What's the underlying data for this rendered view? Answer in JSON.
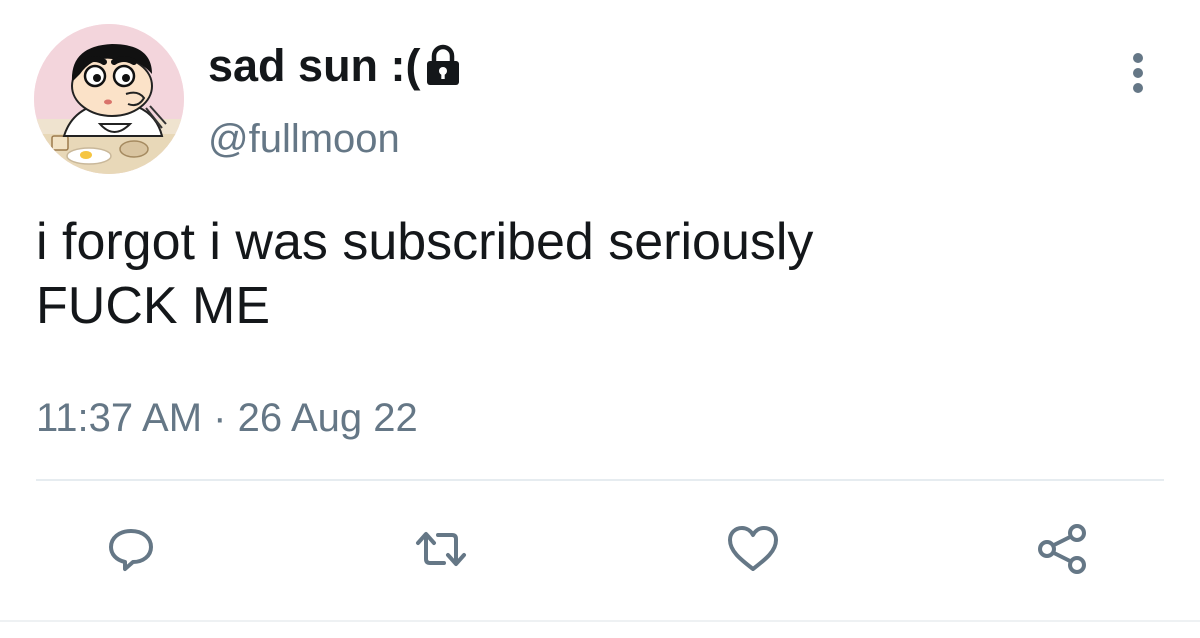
{
  "user": {
    "display_name": "sad sun :(",
    "handle": "@fullmoon",
    "verified_lock": "lock-icon",
    "avatar": "cartoon-boy-avatar"
  },
  "tweet": {
    "text": "i forgot i was subscribed seriously\nFUCK ME",
    "timestamp": "11:37 AM · 26 Aug 22"
  },
  "actions": [
    {
      "name": "reply",
      "icon": "reply-icon"
    },
    {
      "name": "retweet",
      "icon": "retweet-icon"
    },
    {
      "name": "like",
      "icon": "heart-icon"
    },
    {
      "name": "share",
      "icon": "share-icon"
    }
  ],
  "colors": {
    "text": "#14171a",
    "secondary": "#657786",
    "divider": "#e6ecf0"
  }
}
